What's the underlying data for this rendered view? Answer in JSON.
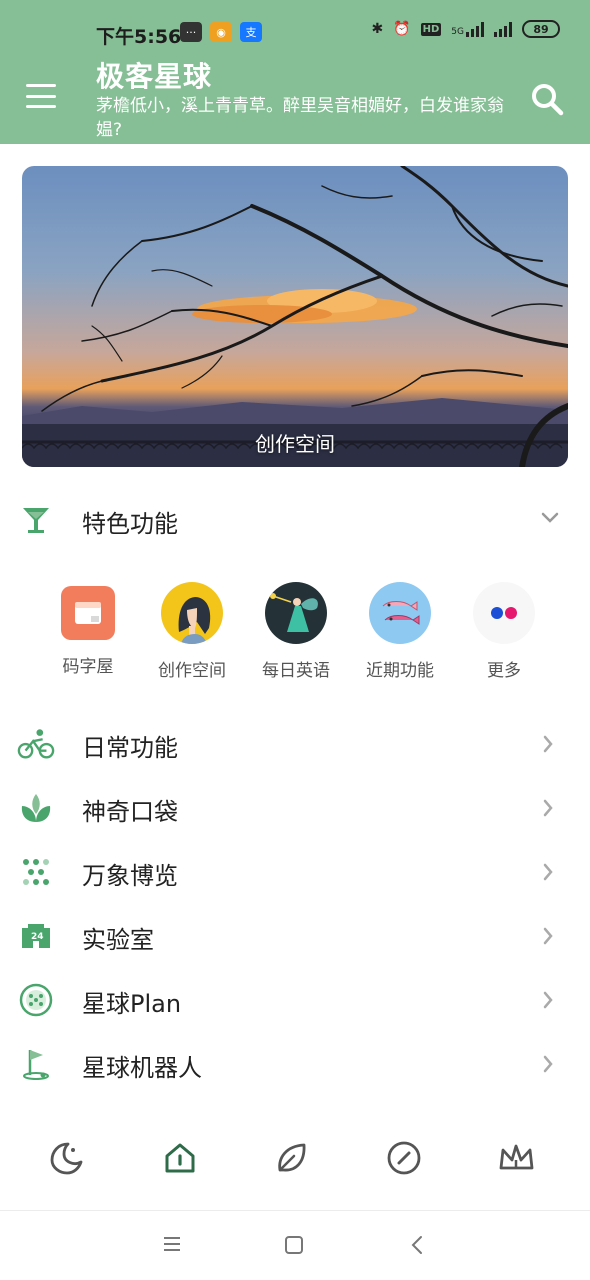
{
  "status_bar": {
    "time": "下午5:56",
    "network_label": "5G",
    "hd_label": "HD",
    "battery": "89"
  },
  "header": {
    "title": "极客星球",
    "subtitle": "茅檐低小，溪上青青草。醉里吴音相媚好，白发谁家翁媪?",
    "background_color": "#86bf95"
  },
  "banner": {
    "caption": "创作空间"
  },
  "featured": {
    "title": "特色功能",
    "accent_color": "#4aa56c",
    "items": [
      {
        "label": "码字屋",
        "icon": "notebook-icon"
      },
      {
        "label": "创作空间",
        "icon": "girl-avatar-icon"
      },
      {
        "label": "每日英语",
        "icon": "fairy-icon"
      },
      {
        "label": "近期功能",
        "icon": "fish-icon"
      },
      {
        "label": "更多",
        "icon": "dots-icon"
      }
    ]
  },
  "menu": [
    {
      "label": "日常功能",
      "icon": "bicycle-icon"
    },
    {
      "label": "神奇口袋",
      "icon": "sprout-icon"
    },
    {
      "label": "万象博览",
      "icon": "dots-pattern-icon"
    },
    {
      "label": "实验室",
      "icon": "building-24-icon"
    },
    {
      "label": "星球Plan",
      "icon": "planet-icon"
    },
    {
      "label": "星球机器人",
      "icon": "golf-flag-icon"
    }
  ],
  "bottom_nav": [
    {
      "icon": "moon-icon"
    },
    {
      "icon": "home-icon",
      "active": true
    },
    {
      "icon": "leaf-icon"
    },
    {
      "icon": "compass-icon"
    },
    {
      "icon": "crown-icon"
    }
  ],
  "system_nav": [
    {
      "icon": "menu-lines-icon"
    },
    {
      "icon": "square-home-icon"
    },
    {
      "icon": "back-arrow-icon"
    }
  ]
}
